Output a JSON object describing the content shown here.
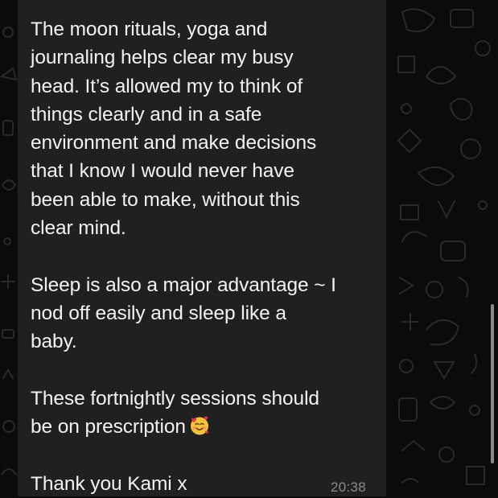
{
  "chat": {
    "message": {
      "paragraphs": [
        "The moon rituals, yoga and\njournaling helps clear my busy\nhead. It’s allowed my to think of\nthings clearly and in a safe\nenvironment and make decisions\nthat I know I would never have\nbeen able to make, without this\nclear mind.",
        "Sleep is also a major advantage ~ I\nnod off easily and sleep like a\nbaby.",
        "These fortnightly sessions should\nbe on prescription",
        "Thank you Kami x"
      ],
      "emoji": "smiling-face-with-hearts",
      "timestamp": "20:38"
    }
  },
  "colors": {
    "background": "#0b0b0b",
    "bubble": "#202020",
    "text": "#f2f2f2",
    "timestamp": "#8c8c8c"
  }
}
